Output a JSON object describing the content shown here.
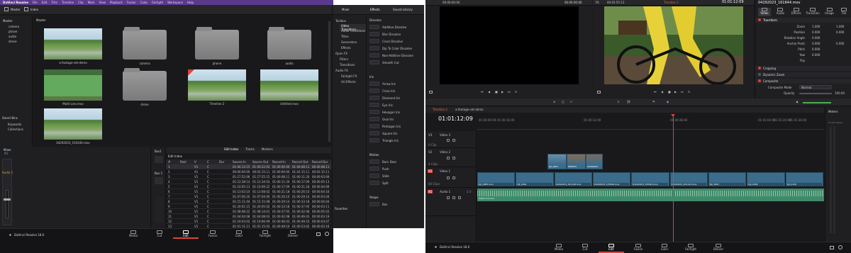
{
  "left": {
    "app_title": "DaVinci Resolve",
    "menu": [
      "File",
      "Edit",
      "Trim",
      "Timeline",
      "Clip",
      "Mark",
      "View",
      "Playback",
      "Fusion",
      "Color",
      "Fairlight",
      "Workspace",
      "Help"
    ],
    "toolbar": {
      "master_label": "Master",
      "index_label": "Index",
      "mixer_label": "Mixer",
      "effects_label": "Effects",
      "sound_library_label": "Sound Library"
    },
    "bins": {
      "master": "Master",
      "items": [
        "camera",
        "phone",
        "audio",
        "drone"
      ],
      "smart_bins": "Smart Bins",
      "smart_items": [
        "Keywords",
        "Collections"
      ]
    },
    "media_pool": {
      "header": "Master",
      "items": [
        {
          "label": "a-footage-set-demo",
          "kind": "clip"
        },
        {
          "label": "camera",
          "kind": "folder"
        },
        {
          "label": "phone",
          "kind": "folder"
        },
        {
          "label": "audio",
          "kind": "folder"
        },
        {
          "label": "Multi-Line.mov",
          "kind": "green"
        },
        {
          "label": "drone",
          "kind": "folder"
        },
        {
          "label": "Timeline 2",
          "kind": "timeline"
        },
        {
          "label": "Untitled.mov",
          "kind": "clip"
        },
        {
          "label": "04292023_161644.mov",
          "kind": "clip"
        }
      ]
    },
    "mixer": {
      "header": "Mixer",
      "track": "A1",
      "channel": "Audio 1",
      "bus1": "Bus1",
      "bus2": "Bus 1"
    },
    "edit_index": {
      "tabs": [
        "Edit Index",
        "Tracks",
        "Markers"
      ],
      "title": "Edit Index",
      "columns": [
        "#",
        "Reel",
        "V",
        "C",
        "Dur",
        "Source In",
        "Source Out",
        "Record In",
        "Record Out",
        "Record Dur"
      ],
      "rows": [
        [
          "1",
          "",
          "V1",
          "C",
          "",
          "01:00:13:15",
          "01:00:22:02",
          "01:00:00:00",
          "01:00:08:11",
          "00:00:08:11"
        ],
        [
          "2",
          "",
          "A1",
          "C",
          "",
          "00:00:00:00",
          "00:02:15:11",
          "01:00:00:00",
          "01:02:15:11",
          "00:02:15:11"
        ],
        [
          "3",
          "",
          "V1",
          "C",
          "",
          "01:27:52:06",
          "01:27:55:15",
          "01:00:08:11",
          "01:00:11:20",
          "00:00:03:09"
        ],
        [
          "4",
          "",
          "V1",
          "C",
          "",
          "01:12:28:14",
          "01:12:34:03",
          "01:00:11:20",
          "01:00:17:09",
          "00:00:05:13"
        ],
        [
          "5",
          "",
          "V1",
          "C",
          "",
          "01:10:05:13",
          "01:10:09:22",
          "01:00:17:09",
          "01:00:21:18",
          "00:00:04:09"
        ],
        [
          "6",
          "",
          "V1",
          "C",
          "",
          "01:13:03:10",
          "01:13:08:02",
          "01:00:21:18",
          "01:00:26:10",
          "00:00:04:16"
        ],
        [
          "7",
          "",
          "V1",
          "C",
          "",
          "01:07:00:20",
          "01:07:04:00",
          "01:00:26:10",
          "01:00:29:14",
          "00:00:03:04"
        ],
        [
          "8",
          "",
          "V1",
          "C",
          "",
          "01:15:11:04",
          "01:15:15:08",
          "01:00:29:14",
          "01:00:33:18",
          "00:00:04:04"
        ],
        [
          "9",
          "",
          "V1",
          "C",
          "",
          "01:20:01:15",
          "01:20:05:02",
          "01:00:33:18",
          "01:00:37:05",
          "00:00:03:11"
        ],
        [
          "10",
          "",
          "V1",
          "C",
          "",
          "01:08:08:22",
          "01:08:14:01",
          "01:00:37:05",
          "01:00:42:08",
          "00:00:05:03"
        ],
        [
          "11",
          "",
          "V1",
          "C",
          "",
          "01:04:04:08",
          "01:04:08:03",
          "01:00:42:08",
          "01:00:46:03",
          "00:00:03:19"
        ],
        [
          "12",
          "",
          "V1",
          "C",
          "",
          "01:19:03:02",
          "01:19:06:09",
          "01:00:46:03",
          "01:00:49:10",
          "00:00:03:07"
        ],
        [
          "13",
          "",
          "V1",
          "C",
          "",
          "01:01:11:11",
          "01:01:15:03",
          "01:00:49:10",
          "01:00:53:02",
          "00:00:03:16"
        ]
      ]
    },
    "effects": {
      "tree": [
        "Toolbox",
        "Video Transitions",
        "Audio Transitions",
        "Titles",
        "Generators",
        "Effects",
        "Open FX",
        "Filters",
        "Transitions",
        "Audio FX",
        "Fairlight FX",
        "AU Effects"
      ],
      "sections": [
        {
          "title": "Dissolve",
          "items": [
            "Additive Dissolve",
            "Blur Dissolve",
            "Cross Dissolve",
            "Dip To Color Dissolve",
            "Non-Additive Dissolve",
            "Smooth Cut"
          ]
        },
        {
          "title": "Iris",
          "items": [
            "Arrow Iris",
            "Cross Iris",
            "Diamond Iris",
            "Eye Iris",
            "Hexagon Iris",
            "Oval Iris",
            "Pentagon Iris",
            "Square Iris",
            "Triangle Iris"
          ]
        },
        {
          "title": "Motion",
          "items": [
            "Barn Door",
            "Push",
            "Slide",
            "Split"
          ]
        },
        {
          "title": "Shape",
          "items": [
            "Box"
          ]
        }
      ],
      "favorites": "Favorites"
    },
    "pages": [
      "Media",
      "Cut",
      "Edit",
      "Fusion",
      "Color",
      "Fairlight",
      "Deliver"
    ],
    "active_page": "Edit",
    "brand": "DaVinci Resolve 18.6"
  },
  "right": {
    "source_timecode_left": "00:00:00:00",
    "source_timecode_right": "00:00:00:00",
    "zoom": "Fit",
    "program_timecode_left": "00:02:55:13",
    "program_title": "Timeline 2",
    "program_timecode_right": "01:01:12:09",
    "clip_name": "04292023_161644.mov",
    "inspector": {
      "tabs": [
        "Video",
        "Audio",
        "Effects",
        "Transition",
        "Image",
        "File"
      ],
      "active_tab": "Video",
      "transform_label": "Transform",
      "params": [
        {
          "label": "Zoom",
          "x": "1.000",
          "y": "1.000"
        },
        {
          "label": "Position",
          "x": "0.000",
          "y": "0.000"
        },
        {
          "label": "Rotation Angle",
          "x": "0.000",
          "y": ""
        },
        {
          "label": "Anchor Point",
          "x": "0.000",
          "y": "0.000"
        },
        {
          "label": "Pitch",
          "x": "0.000",
          "y": ""
        },
        {
          "label": "Yaw",
          "x": "0.000",
          "y": ""
        },
        {
          "label": "Flip",
          "x": "",
          "y": ""
        }
      ],
      "sections": [
        "Cropping",
        "Dynamic Zoom",
        "Composite"
      ],
      "composite_mode_label": "Composite Mode",
      "composite_mode": "Normal",
      "opacity_label": "Opacity",
      "opacity": "100.00"
    },
    "timeline": {
      "tabs": [
        "Timeline 2",
        "a-footage-set-demo"
      ],
      "timecode": "01:01:12:09",
      "ruler": [
        "01:00:00:00",
        "01:00:16:00",
        "01:00:32:00",
        "01:00:48:00",
        "01:01:04:00",
        "01:01:20:00",
        "01:01:36:00"
      ],
      "tracks": [
        {
          "id": "V3",
          "name": "Video 3",
          "clips": "0 Clip"
        },
        {
          "id": "V2",
          "name": "Video 2",
          "clips": "4 Clips"
        },
        {
          "id": "V1",
          "name": "Video 1",
          "clips": "84 Clips"
        },
        {
          "id": "A1",
          "name": "Audio 1",
          "clips": "2.0"
        }
      ],
      "v2_clips": [
        "DJI_0097",
        "DPB303",
        "DPB303",
        "04292023"
      ],
      "v1_clips": [
        "DJI_0085.mov",
        "DJI_0091",
        "04292023_161148.mov",
        "04292023_155946.mov",
        "04292023_155810.mov",
        "04292023_161144.mov",
        "DJI_0097",
        "DJI_0099",
        "DJI_0129"
      ],
      "audio_clip": "Multi-Line.mov",
      "meters": "Meters",
      "control_room": "Control Room"
    },
    "pages": [
      "Media",
      "Cut",
      "Edit",
      "Fusion",
      "Color",
      "Fairlight",
      "Deliver"
    ],
    "active_page": "Edit",
    "brand": "DaVinci Resolve 18.6"
  }
}
